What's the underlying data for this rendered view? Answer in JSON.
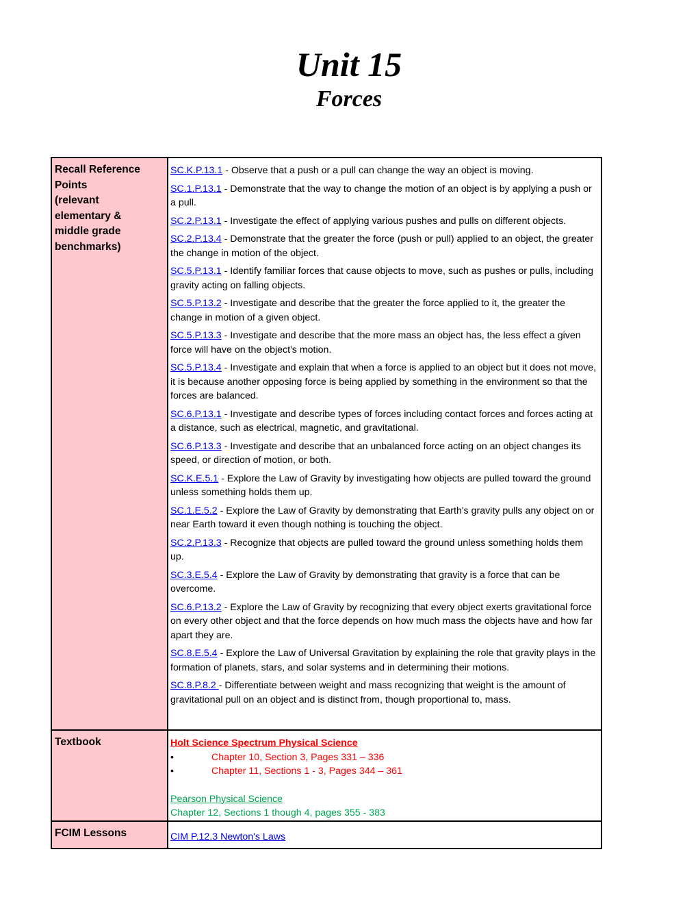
{
  "header": {
    "title": "Unit 15",
    "subtitle": "Forces"
  },
  "recall": {
    "label_lines": [
      "Recall Reference",
      "Points",
      "(relevant",
      "elementary &",
      "middle grade",
      "benchmarks)"
    ],
    "benchmarks": [
      {
        "code": "SC.K.P.13.1",
        "text": " - Observe that a push or a pull can change the way an object is moving."
      },
      {
        "code": "SC.1.P.13.1",
        "text": " - Demonstrate that the way to change the motion of an object is by applying a push or a pull."
      },
      {
        "code": "SC.2.P.13.1",
        "text": " - Investigate the effect of applying various pushes and pulls on different objects."
      },
      {
        "code": "SC.2.P.13.4",
        "text": " - Demonstrate that the greater the force (push or pull) applied to an object, the greater the change in motion of the object."
      },
      {
        "code": "SC.5.P.13.1",
        "text": " - Identify familiar forces that cause objects to move, such as pushes or pulls, including gravity acting on falling objects."
      },
      {
        "code": "SC.5.P.13.2",
        "text": " - Investigate and describe that the greater the force applied to it, the greater the change in motion of a given object."
      },
      {
        "code": "SC.5.P.13.3",
        "text": " - Investigate and describe that the more mass an object has, the less effect a given force will have on the object's motion."
      },
      {
        "code": "SC.5.P.13.4",
        "text": " - Investigate and explain that when a force is applied to an object but it does not move, it is because another opposing force is being applied by something in the environment so that the forces are balanced."
      },
      {
        "code": "SC.6.P.13.1",
        "text": " - Investigate and describe types of forces including contact forces and forces acting at a distance, such as electrical, magnetic, and gravitational."
      },
      {
        "code": "SC.6.P.13.3",
        "text": " - Investigate and describe that an unbalanced force acting on an object changes its speed, or direction of motion, or both."
      },
      {
        "code": "SC.K.E.5.1",
        "text": " - Explore the Law of Gravity by investigating how objects are pulled toward the ground unless something holds them up."
      },
      {
        "code": "SC.1.E.5.2",
        "text": " - Explore the Law of Gravity by demonstrating that Earth's gravity pulls any object on or near Earth toward it even though nothing is touching the object."
      },
      {
        "code": "SC.2.P.13.3",
        "text": " - Recognize that objects are pulled toward the ground unless something holds them up."
      },
      {
        "code": "SC.3.E.5.4",
        "text": " - Explore the Law of Gravity by demonstrating that gravity is a force that can be overcome."
      },
      {
        "code": "SC.6.P.13.2",
        "text": " - Explore the Law of Gravity by recognizing that every object exerts gravitational force on every other object and that the force depends on how much mass the objects have and how far apart they are."
      },
      {
        "code": "SC.8.E.5.4",
        "text": " - Explore the Law of Universal Gravitation by explaining the role that gravity plays in the formation of planets, stars, and solar systems and in determining their motions."
      },
      {
        "code": "SC.8.P.8.2 ",
        "text": "- Differentiate between weight and mass recognizing that weight is the amount of gravitational pull on an object and is distinct from, though proportional to, mass."
      }
    ]
  },
  "textbook": {
    "label": "Textbook",
    "holt_title": "Holt Science Spectrum Physical Science",
    "holt_items": [
      "Chapter 10, Section 3, Pages 331 – 336",
      "Chapter 11, Sections 1 - 3, Pages 344 – 361"
    ],
    "bullet_glyph": "•",
    "pearson_title": "Pearson Physical Science",
    "pearson_detail": "Chapter 12, Sections 1 though 4, pages 355 - 383"
  },
  "fcim": {
    "label": "FCIM Lessons",
    "link": "CIM P.12.3 Newton's Laws"
  },
  "colors": {
    "label_bg": "#ffc7ce",
    "link_blue": "#0000ee",
    "holt_red": "#ff0000",
    "pearson_green": "#00a651"
  }
}
